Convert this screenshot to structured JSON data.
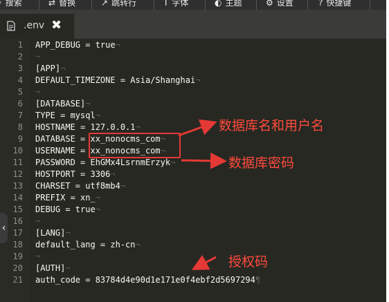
{
  "toolbar": {
    "items": [
      {
        "icon": "search-icon",
        "glyph": "⌕",
        "label": "搜索"
      },
      {
        "icon": "replace-icon",
        "glyph": "⇄",
        "label": "替换"
      },
      {
        "icon": "goto-line-icon",
        "glyph": "↗",
        "label": "跳转行"
      },
      {
        "icon": "font-icon",
        "glyph": "T",
        "label": "字体"
      },
      {
        "icon": "theme-icon",
        "glyph": "◐",
        "label": "主题"
      },
      {
        "icon": "settings-icon",
        "glyph": "⚙",
        "label": "设置"
      },
      {
        "icon": "help-icon",
        "glyph": "?",
        "label": "快捷键"
      }
    ]
  },
  "tab": {
    "filename": ".env",
    "close_glyph": "✖"
  },
  "editor": {
    "lines": [
      {
        "n": "1",
        "text": "APP_DEBUG = true"
      },
      {
        "n": "2",
        "text": ""
      },
      {
        "n": "3",
        "text": "[APP]"
      },
      {
        "n": "4",
        "text": "DEFAULT_TIMEZONE = Asia/Shanghai"
      },
      {
        "n": "5",
        "text": ""
      },
      {
        "n": "6",
        "text": "[DATABASE]"
      },
      {
        "n": "7",
        "text": "TYPE = mysql"
      },
      {
        "n": "8",
        "text": "HOSTNAME = 127.0.0.1"
      },
      {
        "n": "9",
        "text": "DATABASE = xx_nonocms_com"
      },
      {
        "n": "10",
        "text": "USERNAME = xx_nonocms_com"
      },
      {
        "n": "11",
        "text": "PASSWORD = EhGMx4LsrnmErzyk"
      },
      {
        "n": "12",
        "text": "HOSTPORT = 3306"
      },
      {
        "n": "13",
        "text": "CHARSET = utf8mb4"
      },
      {
        "n": "14",
        "text": "PREFIX = xn_"
      },
      {
        "n": "15",
        "text": "DEBUG = true"
      },
      {
        "n": "16",
        "text": ""
      },
      {
        "n": "17",
        "text": "[LANG]"
      },
      {
        "n": "18",
        "text": "default_lang = zh-cn"
      },
      {
        "n": "19",
        "text": ""
      },
      {
        "n": "20",
        "text": "[AUTH]"
      },
      {
        "n": "21",
        "text": "auth_code = 83784d4e90d1e171e0f4ebf2d5697294"
      }
    ]
  },
  "annotations": {
    "db_user": "数据库名和用户名",
    "db_pass": "数据库密码",
    "auth": "授权码",
    "color": "#e53935"
  },
  "left_handle": {
    "glyph": "‹"
  }
}
